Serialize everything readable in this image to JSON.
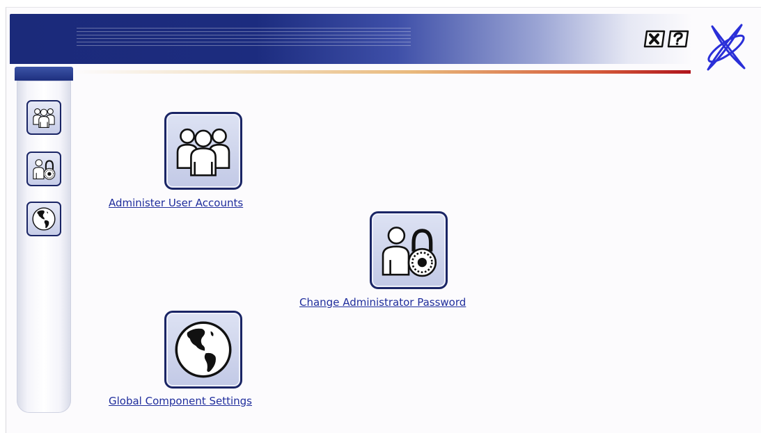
{
  "header": {
    "close_icon": "close-x-icon",
    "help_icon": "help-question-icon",
    "logo_icon": "x-star-logo"
  },
  "sidebar": {
    "items": [
      {
        "id": "users",
        "icon": "users-group-icon"
      },
      {
        "id": "password",
        "icon": "user-lock-icon"
      },
      {
        "id": "global",
        "icon": "globe-icon"
      }
    ]
  },
  "main": {
    "items": [
      {
        "label": "Administer User Accounts",
        "icon": "users-group-icon"
      },
      {
        "label": "Change Administrator Password",
        "icon": "user-lock-icon"
      },
      {
        "label": "Global Component Settings",
        "icon": "globe-icon"
      }
    ]
  },
  "colors": {
    "banner_dark": "#1b2a7a",
    "link": "#1f2d9c",
    "accent_red": "#b0141c",
    "button_border": "#1a2565"
  }
}
